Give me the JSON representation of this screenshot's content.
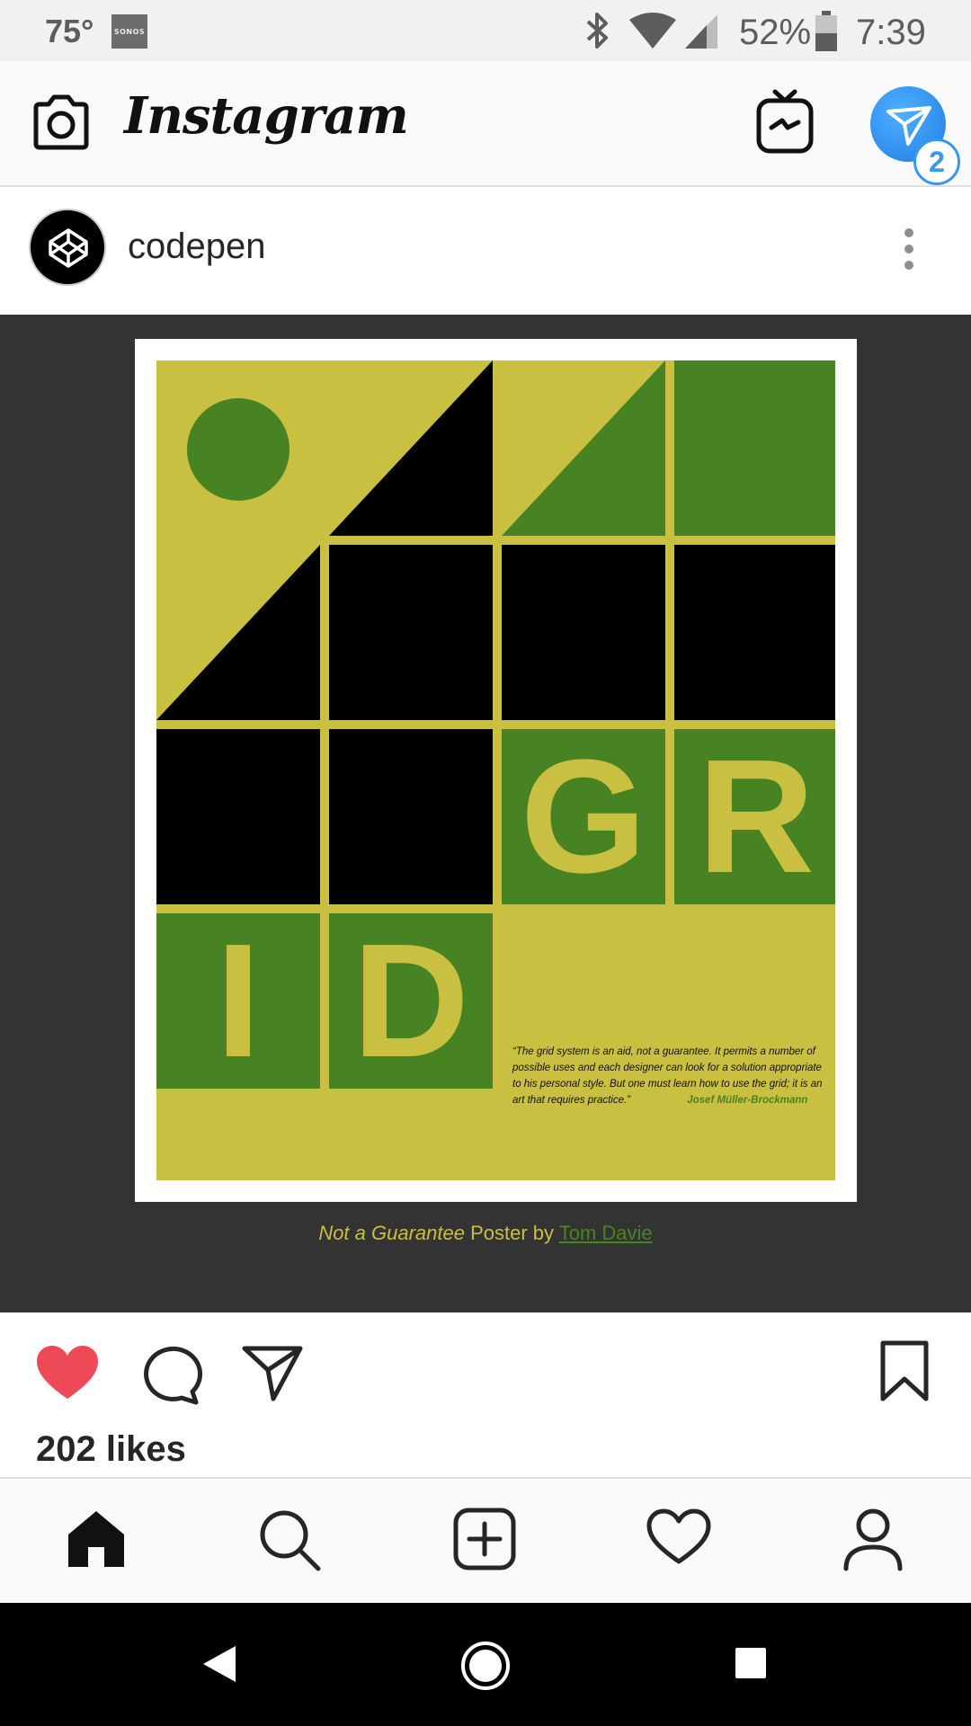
{
  "status_bar": {
    "temperature": "75°",
    "sonos_label": "SONOS",
    "battery": "52%",
    "time": "7:39"
  },
  "header": {
    "logo": "Instagram",
    "dm_badge_count": "2",
    "icons": [
      "camera-icon",
      "igtv-icon",
      "direct-message-icon"
    ]
  },
  "post": {
    "username": "codepen",
    "poster": {
      "letters": [
        "G",
        "R",
        "I",
        "D"
      ],
      "quote": "“The grid system is an aid, not a guarantee. It permits a number of possible uses and each designer can look for a solution appropriate to his personal style. But one must learn how to use the grid; it is an art that requires practice.”",
      "quote_author": "Josef Müller-Brockmann",
      "colors": {
        "olive": "#c9bf40",
        "green": "#488323",
        "black": "#000000"
      }
    },
    "caption": {
      "title": "Not a Guarantee",
      "middle": " Poster by ",
      "author_link": "Tom Davie"
    },
    "likes": "202 likes",
    "liked": true,
    "like_color": "#ed4956"
  },
  "bottom_nav": {
    "items": [
      "home-icon",
      "search-icon",
      "add-post-icon",
      "activity-icon",
      "profile-icon"
    ]
  },
  "system_nav": {
    "items": [
      "back-icon",
      "home-button-icon",
      "recents-icon"
    ]
  }
}
